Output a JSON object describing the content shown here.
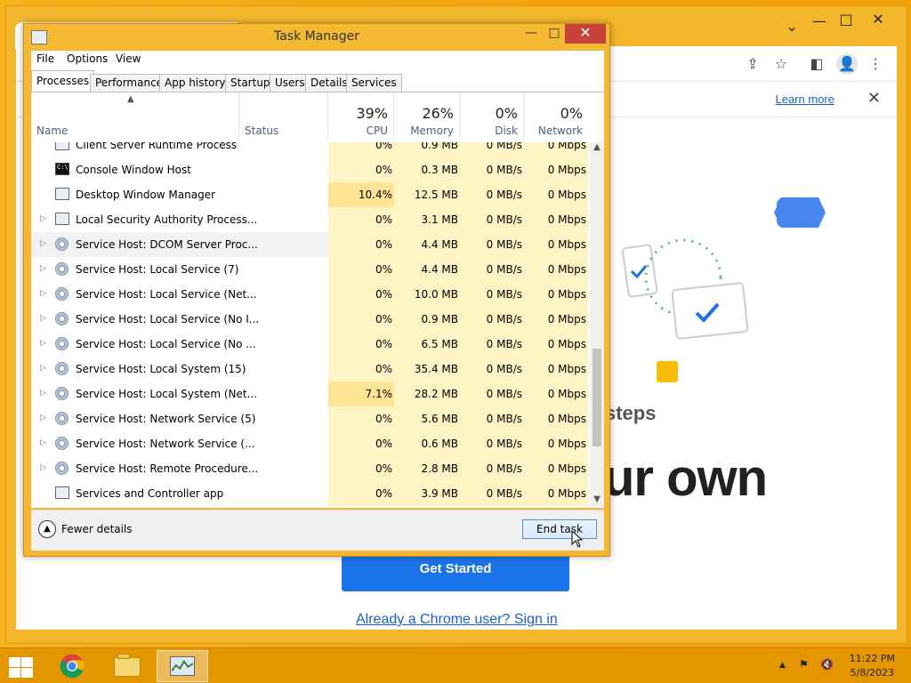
{
  "chrome": {
    "learn_more": "Learn more",
    "info_close": "✕",
    "steps_text": "steps",
    "headline_fragment": "ur own",
    "get_started": "Get Started",
    "signin_link": "Already a Chrome user? Sign in",
    "caption_min": "—",
    "caption_max": "□",
    "caption_close": "✕",
    "tab_dropdown": "⌄"
  },
  "task_manager": {
    "title": "Task Manager",
    "menu": [
      "File",
      "Options",
      "View"
    ],
    "tabs": [
      "Processes",
      "Performance",
      "App history",
      "Startup",
      "Users",
      "Details",
      "Services"
    ],
    "active_tab": "Processes",
    "columns": {
      "name": "Name",
      "status": "Status",
      "cpu_pct": "39%",
      "cpu": "CPU",
      "memory_pct": "26%",
      "memory": "Memory",
      "disk_pct": "0%",
      "disk": "Disk",
      "network_pct": "0%",
      "network": "Network"
    },
    "rows": [
      {
        "name": "Client Server Runtime Process",
        "cpu": "0%",
        "memory": "0.9 MB",
        "disk": "0 MB/s",
        "network": "0 Mbps",
        "icon": "window-icon",
        "expand": false
      },
      {
        "name": "Console Window Host",
        "cpu": "0%",
        "memory": "0.3 MB",
        "disk": "0 MB/s",
        "network": "0 Mbps",
        "icon": "console-icon",
        "expand": false
      },
      {
        "name": "Desktop Window Manager",
        "cpu": "10.4%",
        "memory": "12.5 MB",
        "disk": "0 MB/s",
        "network": "0 Mbps",
        "icon": "window-icon",
        "expand": false,
        "hot": true
      },
      {
        "name": "Local Security Authority Process...",
        "cpu": "0%",
        "memory": "3.1 MB",
        "disk": "0 MB/s",
        "network": "0 Mbps",
        "icon": "window-icon",
        "expand": true
      },
      {
        "name": "Service Host: DCOM Server Proc...",
        "cpu": "0%",
        "memory": "4.4 MB",
        "disk": "0 MB/s",
        "network": "0 Mbps",
        "icon": "gear-icon",
        "expand": true,
        "selected": true
      },
      {
        "name": "Service Host: Local Service (7)",
        "cpu": "0%",
        "memory": "4.4 MB",
        "disk": "0 MB/s",
        "network": "0 Mbps",
        "icon": "gear-icon",
        "expand": true
      },
      {
        "name": "Service Host: Local Service (Net...",
        "cpu": "0%",
        "memory": "10.0 MB",
        "disk": "0 MB/s",
        "network": "0 Mbps",
        "icon": "gear-icon",
        "expand": true
      },
      {
        "name": "Service Host: Local Service (No I...",
        "cpu": "0%",
        "memory": "0.9 MB",
        "disk": "0 MB/s",
        "network": "0 Mbps",
        "icon": "gear-icon",
        "expand": true
      },
      {
        "name": "Service Host: Local Service (No ...",
        "cpu": "0%",
        "memory": "6.5 MB",
        "disk": "0 MB/s",
        "network": "0 Mbps",
        "icon": "gear-icon",
        "expand": true
      },
      {
        "name": "Service Host: Local System (15)",
        "cpu": "0%",
        "memory": "35.4 MB",
        "disk": "0 MB/s",
        "network": "0 Mbps",
        "icon": "gear-icon",
        "expand": true
      },
      {
        "name": "Service Host: Local System (Net...",
        "cpu": "7.1%",
        "memory": "28.2 MB",
        "disk": "0 MB/s",
        "network": "0 Mbps",
        "icon": "gear-icon",
        "expand": true,
        "hot": true
      },
      {
        "name": "Service Host: Network Service (5)",
        "cpu": "0%",
        "memory": "5.6 MB",
        "disk": "0 MB/s",
        "network": "0 Mbps",
        "icon": "gear-icon",
        "expand": true
      },
      {
        "name": "Service Host: Network Service (...",
        "cpu": "0%",
        "memory": "0.6 MB",
        "disk": "0 MB/s",
        "network": "0 Mbps",
        "icon": "gear-icon",
        "expand": true
      },
      {
        "name": "Service Host: Remote Procedure...",
        "cpu": "0%",
        "memory": "2.8 MB",
        "disk": "0 MB/s",
        "network": "0 Mbps",
        "icon": "gear-icon",
        "expand": true
      },
      {
        "name": "Services and Controller app",
        "cpu": "0%",
        "memory": "3.9 MB",
        "disk": "0 MB/s",
        "network": "0 Mbps",
        "icon": "window-icon",
        "expand": false
      }
    ],
    "fewer_details": "Fewer details",
    "end_task": "End task",
    "btn_min": "—",
    "btn_max": "□",
    "btn_close": "✕"
  },
  "taskbar": {
    "time": "11:22 PM",
    "date": "5/8/2023",
    "tray_up": "▲"
  },
  "colors": {
    "accent_blue": "#1a73e8",
    "desktop": "#f3a20e",
    "close_red": "#c7403a"
  }
}
